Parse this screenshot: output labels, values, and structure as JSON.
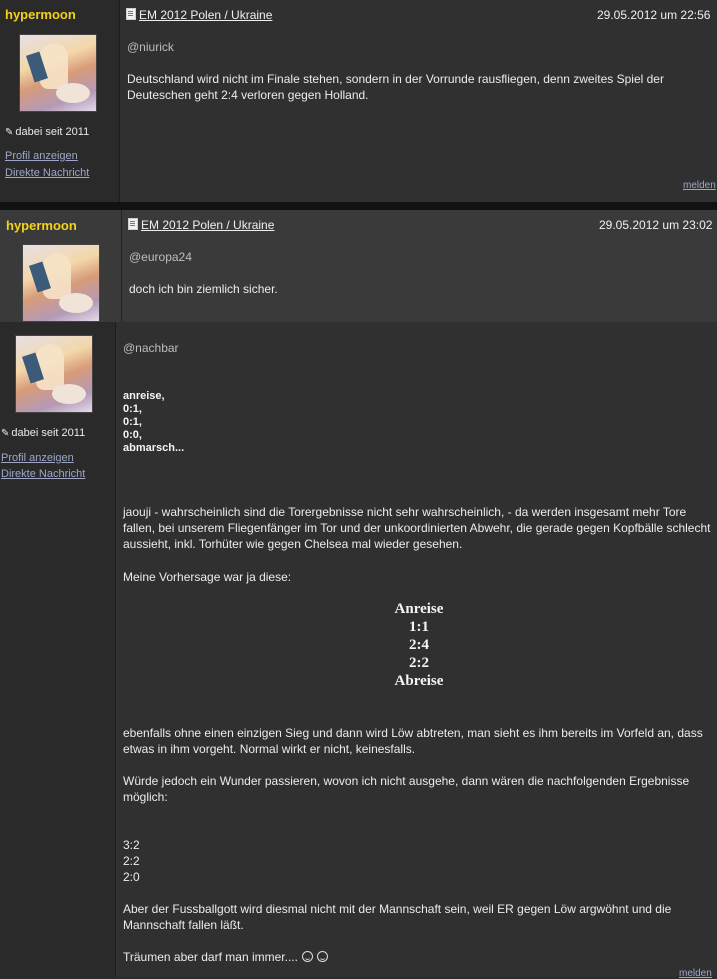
{
  "post1": {
    "username": "hypermoon",
    "member_since": "dabei seit 2011",
    "profile_link": "Profil anzeigen",
    "message_link": "Direkte Nachricht",
    "topic": "EM 2012 Polen / Ukraine",
    "date": "29.05.2012 um 22:56",
    "mention": "@niurick",
    "text": "Deutschland wird nicht im Finale stehen, sondern in der Vorrunde rausfliegen, denn zweites Spiel der Deuteschen geht 2:4 verloren gegen Holland.",
    "report": "melden"
  },
  "post2": {
    "username": "hypermoon",
    "topic": "EM 2012 Polen / Ukraine",
    "date": "29.05.2012 um 23:02",
    "mention": "@europa24",
    "text": "doch ich bin ziemlich sicher."
  },
  "post3": {
    "member_since": "dabei seit 2011",
    "profile_link": "Profil anzeigen",
    "message_link": "Direkte Nachricht",
    "mention": "@nachbar",
    "bold_lines": [
      "anreise,",
      "0:1,",
      "0:1,",
      "0:0,",
      "abmarsch..."
    ],
    "paragraph1": "jaouji - wahrscheinlich sind die Torergebnisse nicht sehr wahrscheinlich, - da werden insgesamt mehr Tore fallen, bei unserem Fliegenfänger im Tor und der unkoordinierten Abwehr, die gerade gegen Kopfbälle schlecht aussieht, inkl. Torhüter wie gegen Chelsea mal wieder gesehen.",
    "paragraph2": "Meine Vorhersage war ja diese:",
    "prediction": [
      "Anreise",
      "1:1",
      "2:4",
      "2:2",
      "Abreise"
    ],
    "paragraph3": "ebenfalls ohne einen einzigen Sieg und dann wird Löw abtreten, man sieht es ihm bereits im Vorfeld an, dass etwas in ihm vorgeht. Normal wirkt er nicht, keinesfalls.",
    "paragraph4": "Würde jedoch ein Wunder passieren, wovon ich nicht ausgehe, dann wären die nachfolgenden Ergebnisse möglich:",
    "results": [
      "3:2",
      "2:2",
      "2:0"
    ],
    "paragraph5": "Aber der Fussballgott wird diesmal nicht mit der Mannschaft sein, weil ER gegen Löw argwöhnt und die Mannschaft fallen läßt.",
    "paragraph6": "Träumen aber darf man immer....",
    "report": "melden"
  },
  "colors": {
    "username": "#f2d21b",
    "link": "#9ea7c8",
    "background": "#2b2b2b"
  }
}
